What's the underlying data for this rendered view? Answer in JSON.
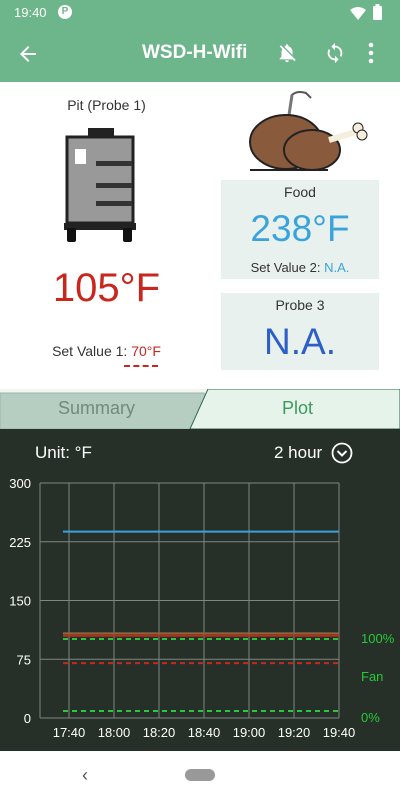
{
  "status": {
    "time": "19:40",
    "p_icon": "P",
    "icons": [
      "wifi-icon",
      "battery-icon"
    ]
  },
  "app_bar": {
    "title": "WSD-H-Wifi",
    "icons": [
      "back-arrow-icon",
      "bell-off-icon",
      "sync-icon",
      "more-vert-icon"
    ]
  },
  "pit": {
    "label": "Pit (Probe 1)",
    "temp": "105°F",
    "set_label": "Set Value 1: ",
    "set_value": "70°F"
  },
  "food": {
    "label": "Food",
    "temp": "238°F",
    "set_label": "Set Value 2: ",
    "set_value": "N.A."
  },
  "probe3": {
    "label": "Probe 3",
    "temp": "N.A."
  },
  "tabs": {
    "summary": "Summary",
    "plot": "Plot",
    "selected": "Plot"
  },
  "chart_header": {
    "unit": "Unit: °F",
    "range": "2 hour"
  },
  "colors": {
    "accent": "#6db58a",
    "pit": "#c9261e",
    "food": "#3aa3dd",
    "probe3": "#2c5fc9",
    "fan": "#27c93a",
    "chart_bg": "#263028"
  },
  "chart_data": {
    "type": "line",
    "x_ticks": [
      "17:40",
      "18:00",
      "18:20",
      "18:40",
      "19:00",
      "19:20",
      "19:40"
    ],
    "y_ticks": [
      "0",
      "75",
      "150",
      "225",
      "300"
    ],
    "ylim": [
      0,
      300
    ],
    "right_axis_labels": [
      "100%",
      "Fan",
      "0%"
    ],
    "series": [
      {
        "color": "#3aa3dd",
        "style": "solid",
        "values": [
          238,
          238
        ]
      },
      {
        "color": "#c9261e",
        "style": "solid",
        "values": [
          105,
          105
        ]
      },
      {
        "color": "#c9261e",
        "style": "dashed",
        "values": [
          70,
          70
        ]
      },
      {
        "color": "#8a6a3a",
        "style": "solid",
        "values": [
          108,
          108
        ]
      },
      {
        "color": "#27c93a",
        "style": "dashed",
        "axis": "right",
        "values": [
          100,
          100
        ]
      },
      {
        "color": "#27c93a",
        "style": "dashed",
        "axis": "right",
        "values": [
          0,
          0
        ]
      }
    ]
  }
}
